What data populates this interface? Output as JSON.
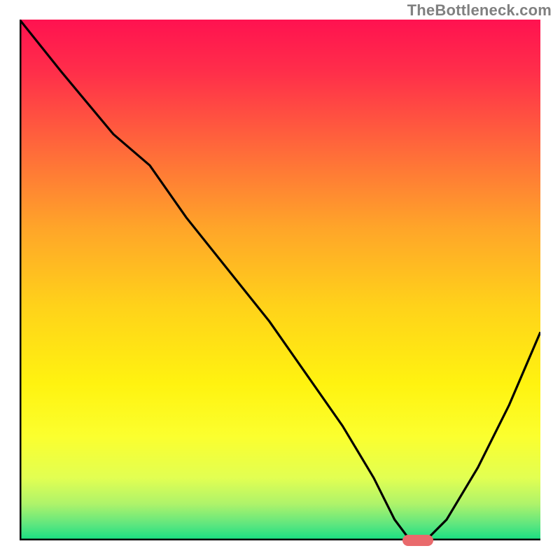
{
  "watermark": "TheBottleneck.com",
  "chart_data": {
    "type": "line",
    "title": "",
    "xlabel": "",
    "ylabel": "",
    "xlim": [
      0,
      100
    ],
    "ylim": [
      0,
      100
    ],
    "grid": false,
    "legend": false,
    "series": [
      {
        "name": "bottleneck-curve",
        "x": [
          0,
          8,
          18,
          25,
          32,
          40,
          48,
          55,
          62,
          68,
          72,
          75,
          78,
          82,
          88,
          94,
          100
        ],
        "y": [
          100,
          90,
          78,
          72,
          62,
          52,
          42,
          32,
          22,
          12,
          4,
          0,
          0,
          4,
          14,
          26,
          40
        ]
      }
    ],
    "marker": {
      "x": 76.5,
      "y": 0,
      "width_pct": 6,
      "height_pct": 2.2,
      "color": "#e96a6c"
    },
    "gradient_stops": [
      {
        "offset": 0.0,
        "color": "#ff1250"
      },
      {
        "offset": 0.1,
        "color": "#ff2e4a"
      },
      {
        "offset": 0.25,
        "color": "#ff6a3a"
      },
      {
        "offset": 0.4,
        "color": "#ffa529"
      },
      {
        "offset": 0.55,
        "color": "#ffd21a"
      },
      {
        "offset": 0.7,
        "color": "#fff310"
      },
      {
        "offset": 0.8,
        "color": "#fbff2e"
      },
      {
        "offset": 0.88,
        "color": "#e2ff52"
      },
      {
        "offset": 0.93,
        "color": "#aef36a"
      },
      {
        "offset": 0.97,
        "color": "#5de67f"
      },
      {
        "offset": 1.0,
        "color": "#15df83"
      }
    ],
    "axis_color": "#000000",
    "axis_width": 5,
    "curve_color": "#000000",
    "curve_width": 3.2
  }
}
